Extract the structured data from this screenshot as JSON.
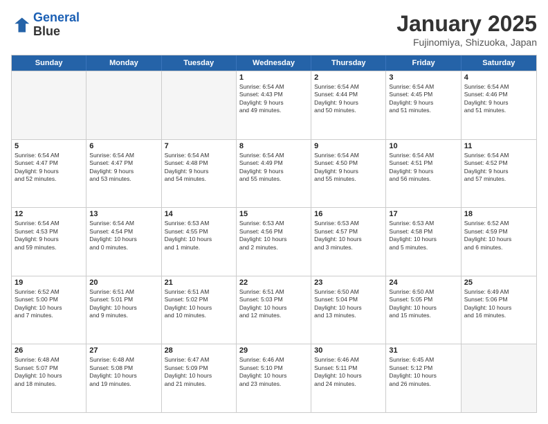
{
  "header": {
    "logo_line1": "General",
    "logo_line2": "Blue",
    "month": "January 2025",
    "location": "Fujinomiya, Shizuoka, Japan"
  },
  "days": [
    "Sunday",
    "Monday",
    "Tuesday",
    "Wednesday",
    "Thursday",
    "Friday",
    "Saturday"
  ],
  "rows": [
    [
      {
        "day": "",
        "info": ""
      },
      {
        "day": "",
        "info": ""
      },
      {
        "day": "",
        "info": ""
      },
      {
        "day": "1",
        "info": "Sunrise: 6:54 AM\nSunset: 4:43 PM\nDaylight: 9 hours\nand 49 minutes."
      },
      {
        "day": "2",
        "info": "Sunrise: 6:54 AM\nSunset: 4:44 PM\nDaylight: 9 hours\nand 50 minutes."
      },
      {
        "day": "3",
        "info": "Sunrise: 6:54 AM\nSunset: 4:45 PM\nDaylight: 9 hours\nand 51 minutes."
      },
      {
        "day": "4",
        "info": "Sunrise: 6:54 AM\nSunset: 4:46 PM\nDaylight: 9 hours\nand 51 minutes."
      }
    ],
    [
      {
        "day": "5",
        "info": "Sunrise: 6:54 AM\nSunset: 4:47 PM\nDaylight: 9 hours\nand 52 minutes."
      },
      {
        "day": "6",
        "info": "Sunrise: 6:54 AM\nSunset: 4:47 PM\nDaylight: 9 hours\nand 53 minutes."
      },
      {
        "day": "7",
        "info": "Sunrise: 6:54 AM\nSunset: 4:48 PM\nDaylight: 9 hours\nand 54 minutes."
      },
      {
        "day": "8",
        "info": "Sunrise: 6:54 AM\nSunset: 4:49 PM\nDaylight: 9 hours\nand 55 minutes."
      },
      {
        "day": "9",
        "info": "Sunrise: 6:54 AM\nSunset: 4:50 PM\nDaylight: 9 hours\nand 55 minutes."
      },
      {
        "day": "10",
        "info": "Sunrise: 6:54 AM\nSunset: 4:51 PM\nDaylight: 9 hours\nand 56 minutes."
      },
      {
        "day": "11",
        "info": "Sunrise: 6:54 AM\nSunset: 4:52 PM\nDaylight: 9 hours\nand 57 minutes."
      }
    ],
    [
      {
        "day": "12",
        "info": "Sunrise: 6:54 AM\nSunset: 4:53 PM\nDaylight: 9 hours\nand 59 minutes."
      },
      {
        "day": "13",
        "info": "Sunrise: 6:54 AM\nSunset: 4:54 PM\nDaylight: 10 hours\nand 0 minutes."
      },
      {
        "day": "14",
        "info": "Sunrise: 6:53 AM\nSunset: 4:55 PM\nDaylight: 10 hours\nand 1 minute."
      },
      {
        "day": "15",
        "info": "Sunrise: 6:53 AM\nSunset: 4:56 PM\nDaylight: 10 hours\nand 2 minutes."
      },
      {
        "day": "16",
        "info": "Sunrise: 6:53 AM\nSunset: 4:57 PM\nDaylight: 10 hours\nand 3 minutes."
      },
      {
        "day": "17",
        "info": "Sunrise: 6:53 AM\nSunset: 4:58 PM\nDaylight: 10 hours\nand 5 minutes."
      },
      {
        "day": "18",
        "info": "Sunrise: 6:52 AM\nSunset: 4:59 PM\nDaylight: 10 hours\nand 6 minutes."
      }
    ],
    [
      {
        "day": "19",
        "info": "Sunrise: 6:52 AM\nSunset: 5:00 PM\nDaylight: 10 hours\nand 7 minutes."
      },
      {
        "day": "20",
        "info": "Sunrise: 6:51 AM\nSunset: 5:01 PM\nDaylight: 10 hours\nand 9 minutes."
      },
      {
        "day": "21",
        "info": "Sunrise: 6:51 AM\nSunset: 5:02 PM\nDaylight: 10 hours\nand 10 minutes."
      },
      {
        "day": "22",
        "info": "Sunrise: 6:51 AM\nSunset: 5:03 PM\nDaylight: 10 hours\nand 12 minutes."
      },
      {
        "day": "23",
        "info": "Sunrise: 6:50 AM\nSunset: 5:04 PM\nDaylight: 10 hours\nand 13 minutes."
      },
      {
        "day": "24",
        "info": "Sunrise: 6:50 AM\nSunset: 5:05 PM\nDaylight: 10 hours\nand 15 minutes."
      },
      {
        "day": "25",
        "info": "Sunrise: 6:49 AM\nSunset: 5:06 PM\nDaylight: 10 hours\nand 16 minutes."
      }
    ],
    [
      {
        "day": "26",
        "info": "Sunrise: 6:48 AM\nSunset: 5:07 PM\nDaylight: 10 hours\nand 18 minutes."
      },
      {
        "day": "27",
        "info": "Sunrise: 6:48 AM\nSunset: 5:08 PM\nDaylight: 10 hours\nand 19 minutes."
      },
      {
        "day": "28",
        "info": "Sunrise: 6:47 AM\nSunset: 5:09 PM\nDaylight: 10 hours\nand 21 minutes."
      },
      {
        "day": "29",
        "info": "Sunrise: 6:46 AM\nSunset: 5:10 PM\nDaylight: 10 hours\nand 23 minutes."
      },
      {
        "day": "30",
        "info": "Sunrise: 6:46 AM\nSunset: 5:11 PM\nDaylight: 10 hours\nand 24 minutes."
      },
      {
        "day": "31",
        "info": "Sunrise: 6:45 AM\nSunset: 5:12 PM\nDaylight: 10 hours\nand 26 minutes."
      },
      {
        "day": "",
        "info": ""
      }
    ]
  ]
}
